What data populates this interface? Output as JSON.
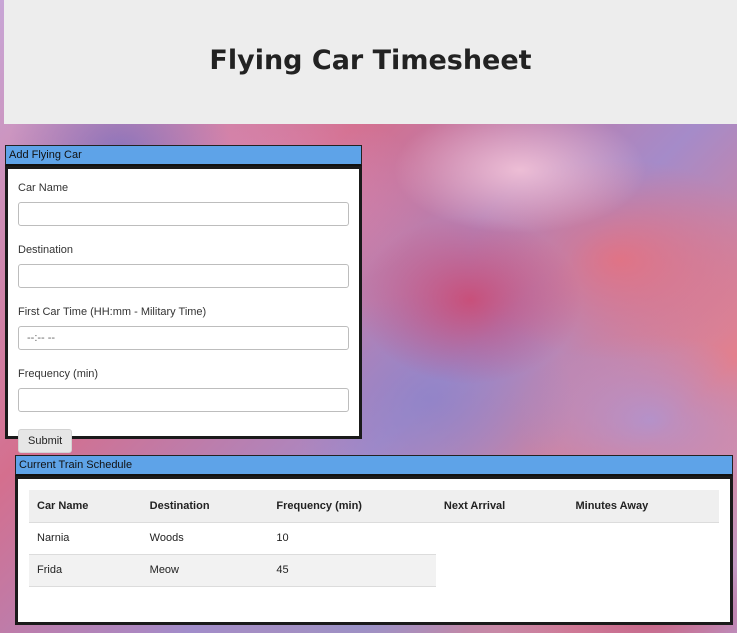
{
  "header": {
    "title": "Flying Car Timesheet"
  },
  "add_panel": {
    "title": "Add Flying Car",
    "fields": [
      {
        "label": "Car Name",
        "value": "",
        "placeholder": ""
      },
      {
        "label": "Destination",
        "value": "",
        "placeholder": ""
      },
      {
        "label": "First Car Time (HH:mm - Military Time)",
        "value": "",
        "placeholder": "--:-- --"
      },
      {
        "label": "Frequency (min)",
        "value": "",
        "placeholder": ""
      }
    ],
    "submit_label": "Submit"
  },
  "schedule_panel": {
    "title": "Current Train Schedule",
    "columns": [
      "Car Name",
      "Destination",
      "Frequency (min)",
      "Next Arrival",
      "Minutes Away"
    ],
    "rows": [
      {
        "name": "Narnia",
        "destination": "Woods",
        "frequency": "10",
        "next_arrival": "",
        "minutes_away": ""
      },
      {
        "name": "Frida",
        "destination": "Meow",
        "frequency": "45",
        "next_arrival": "",
        "minutes_away": ""
      }
    ]
  }
}
